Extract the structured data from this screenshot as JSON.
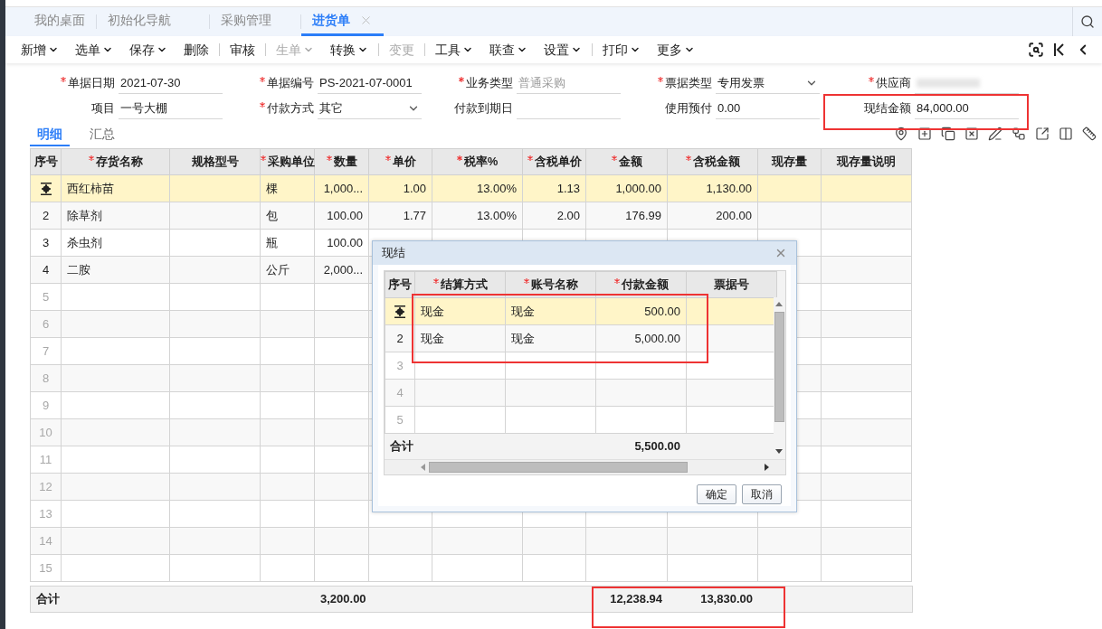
{
  "tabs": [
    {
      "label": "我的桌面",
      "selected": false,
      "closable": false
    },
    {
      "label": "初始化导航",
      "selected": false,
      "closable": false
    },
    {
      "label": "采购管理",
      "selected": false,
      "closable": false
    },
    {
      "label": "进货单",
      "selected": true,
      "closable": true
    }
  ],
  "toolbar": [
    {
      "kind": "button",
      "label": "新增",
      "dropdown": true,
      "disabled": false
    },
    {
      "kind": "button",
      "label": "选单",
      "dropdown": true,
      "disabled": false
    },
    {
      "kind": "button",
      "label": "保存",
      "dropdown": true,
      "disabled": false
    },
    {
      "kind": "button",
      "label": "删除",
      "dropdown": false,
      "disabled": false
    },
    {
      "kind": "separator"
    },
    {
      "kind": "button",
      "label": "审核",
      "dropdown": false,
      "disabled": false
    },
    {
      "kind": "separator"
    },
    {
      "kind": "button",
      "label": "生单",
      "dropdown": true,
      "disabled": true
    },
    {
      "kind": "button",
      "label": "转换",
      "dropdown": true,
      "disabled": false
    },
    {
      "kind": "separator"
    },
    {
      "kind": "button",
      "label": "变更",
      "dropdown": false,
      "disabled": true
    },
    {
      "kind": "separator"
    },
    {
      "kind": "button",
      "label": "工具",
      "dropdown": true,
      "disabled": false
    },
    {
      "kind": "button",
      "label": "联查",
      "dropdown": true,
      "disabled": false
    },
    {
      "kind": "button",
      "label": "设置",
      "dropdown": true,
      "disabled": false
    },
    {
      "kind": "separator"
    },
    {
      "kind": "button",
      "label": "打印",
      "dropdown": true,
      "disabled": false
    },
    {
      "kind": "button",
      "label": "更多",
      "dropdown": true,
      "disabled": false
    }
  ],
  "form": {
    "rows": [
      [
        {
          "label": "单据日期",
          "required": true,
          "kind": "text",
          "value": "2021-07-30",
          "disabled": false
        },
        {
          "label": "单据编号",
          "required": true,
          "kind": "text",
          "value": "PS-2021-07-0001",
          "disabled": false
        },
        {
          "label": "业务类型",
          "required": true,
          "kind": "text",
          "value": "普通采购",
          "disabled": true
        },
        {
          "label": "票据类型",
          "required": true,
          "kind": "select",
          "value": "专用发票",
          "disabled": false
        },
        {
          "label": "供应商",
          "required": true,
          "kind": "blurred"
        }
      ],
      [
        {
          "label": "项目",
          "required": false,
          "kind": "text",
          "value": "一号大棚",
          "disabled": false
        },
        {
          "label": "付款方式",
          "required": true,
          "kind": "select",
          "value": "其它",
          "disabled": false
        },
        {
          "label": "付款到期日",
          "required": false,
          "kind": "text"
        },
        {
          "label": "使用预付",
          "required": false,
          "kind": "text",
          "value": "0.00",
          "disabled": false
        },
        {
          "label": "现结金额",
          "required": false,
          "kind": "text",
          "value": "84,000.00",
          "disabled": false
        }
      ]
    ]
  },
  "detail_tabs": [
    {
      "label": "明细",
      "selected": true
    },
    {
      "label": "汇总",
      "selected": false
    }
  ],
  "table": {
    "columns": [
      {
        "label": "序号",
        "required": false
      },
      {
        "label": "存货名称",
        "required": true
      },
      {
        "label": "规格型号",
        "required": false
      },
      {
        "label": "采购单位",
        "required": true
      },
      {
        "label": "数量",
        "required": true
      },
      {
        "label": "单价",
        "required": true
      },
      {
        "label": "税率%",
        "required": true
      },
      {
        "label": "含税单价",
        "required": true
      },
      {
        "label": "金额",
        "required": true
      },
      {
        "label": "含税金额",
        "required": true
      },
      {
        "label": "现存量",
        "required": false
      },
      {
        "label": "现存量说明",
        "required": false
      }
    ],
    "rows": [
      {
        "selected": true,
        "cells": [
          "西红柿苗",
          null,
          "棵",
          "1,000...",
          "1.00",
          "13.00%",
          "1.13",
          "1,000.00",
          "1,130.00"
        ]
      },
      {
        "selected": false,
        "no": "2",
        "cells": [
          "除草剂",
          null,
          "包",
          "100.00",
          "1.77",
          "13.00%",
          "2.00",
          "176.99",
          "200.00"
        ]
      },
      {
        "selected": false,
        "no": "3",
        "cells": [
          "杀虫剂",
          null,
          "瓶",
          "100.00"
        ]
      },
      {
        "selected": false,
        "no": "4",
        "cells": [
          "二胺",
          null,
          "公斤",
          "2,000..."
        ]
      },
      {
        "selected": false,
        "no": "5"
      },
      {
        "selected": false,
        "no": "6"
      },
      {
        "selected": false,
        "no": "7"
      },
      {
        "selected": false,
        "no": "8"
      },
      {
        "selected": false,
        "no": "9"
      },
      {
        "selected": false,
        "no": "10"
      },
      {
        "selected": false,
        "no": "11"
      },
      {
        "selected": false,
        "no": "12"
      },
      {
        "selected": false,
        "no": "13"
      },
      {
        "selected": false,
        "no": "14"
      },
      {
        "selected": false,
        "no": "15"
      }
    ],
    "footer": {
      "label": "合计",
      "cells": [
        null,
        null,
        null,
        "3,200.00",
        null,
        null,
        null,
        "12,238.94",
        "13,830.00"
      ]
    }
  },
  "dialog": {
    "title": "现结",
    "table": {
      "columns": [
        {
          "label": "序号",
          "required": false
        },
        {
          "label": "结算方式",
          "required": true
        },
        {
          "label": "账号名称",
          "required": true
        },
        {
          "label": "付款金额",
          "required": true
        },
        {
          "label": "票据号",
          "required": false
        }
      ],
      "rows": [
        {
          "selected": true,
          "cells": [
            "现金",
            "现金",
            "500.00"
          ]
        },
        {
          "selected": false,
          "no": "2",
          "cells": [
            "现金",
            "现金",
            "5,000.00"
          ]
        },
        {
          "selected": false,
          "no": "3"
        },
        {
          "selected": false,
          "no": "4"
        },
        {
          "selected": false,
          "no": "5"
        }
      ],
      "footer": {
        "label": "合计",
        "cells": [
          null,
          null,
          "5,500.00"
        ]
      }
    },
    "buttons": [
      "确定",
      "取消"
    ]
  }
}
